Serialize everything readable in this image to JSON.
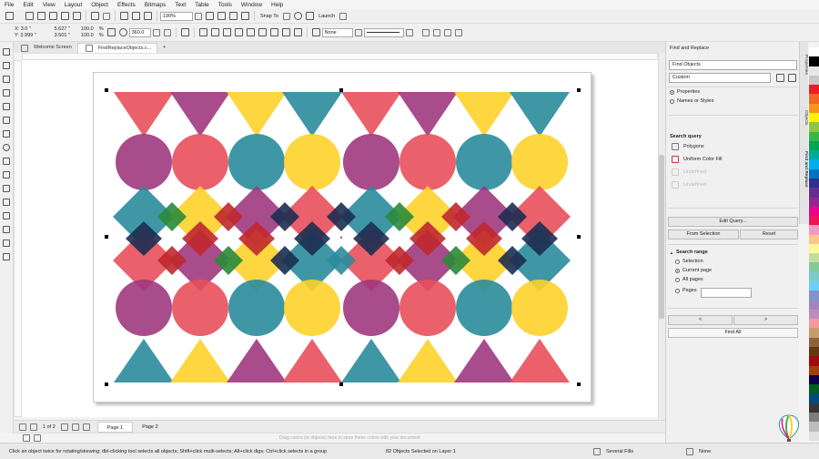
{
  "menu": [
    "File",
    "Edit",
    "View",
    "Layout",
    "Object",
    "Effects",
    "Bitmaps",
    "Text",
    "Table",
    "Tools",
    "Window",
    "Help"
  ],
  "toolbar": {
    "zoom": "190%",
    "snap_to": "Snap To",
    "launch": "Launch"
  },
  "propbar": {
    "x": "X: 3.0 \"",
    "y": "Y: 3.999 \"",
    "w": "5.627 \"",
    "h": "3.501 \"",
    "sx": "100.0",
    "sy": "100.0",
    "pct": "%",
    "angle": "360.0",
    "outline": "None"
  },
  "tabs": {
    "welcome": "Welcome Screen",
    "doc": "FindReplaceObjects.c...",
    "add": "+"
  },
  "pages": {
    "count": "1 of 2",
    "page1": "Page 1",
    "page2": "Page 2"
  },
  "hint": "Drag colors (or objects) here to store these colors with your document",
  "status": {
    "tip": "Click an object twice for rotating/skewing; dbl-clicking tool selects all objects; Shift+click multi-selects; Alt+click digs; Ctrl+click selects in a group",
    "selected": "82 Objects Selected on Layer 1",
    "fill": "Several Fills",
    "outline": "None"
  },
  "docker": {
    "title": "Find and Replace",
    "mode": "Find Objects",
    "preset": "Custom",
    "radio_properties": "Properties",
    "radio_names": "Names or Styles",
    "search_query": "Search query",
    "q1": "Polygons",
    "q2": "Uniform Color Fill",
    "q3": "Undefined",
    "q4": "Undefined",
    "edit_query": "Edit Query...",
    "from_selection": "From Selection",
    "reset": "Reset",
    "search_range": "Search range",
    "r_selection": "Selection",
    "r_current": "Current page",
    "r_all": "All pages",
    "r_pages": "Pages",
    "prev": "<",
    "next": ">",
    "find_all": "Find All"
  },
  "vtabs": [
    "Properties",
    "Objects",
    "Find and Replace"
  ],
  "colors": {
    "pink": "#e8505b",
    "purple": "#a0397e",
    "yellow": "#fdd22b",
    "teal": "#2a8c9c",
    "green": "#2a8a3a",
    "navy": "#1c2d52",
    "red": "#c0282e",
    "darkteal": "#1f5a63"
  },
  "palette": [
    "#ffffff",
    "#000000",
    "#e6e6e6",
    "#c8c8c8",
    "#ed1c24",
    "#f26522",
    "#f7941d",
    "#fff200",
    "#8dc63f",
    "#39b54a",
    "#00a651",
    "#00a99d",
    "#00aeef",
    "#0072bc",
    "#2e3192",
    "#662d91",
    "#92278f",
    "#ec008c",
    "#ed145b",
    "#f49ac1",
    "#fdc689",
    "#fff799",
    "#c4df9b",
    "#82ca9c",
    "#7accc8",
    "#6dcff6",
    "#8393ca",
    "#a186be",
    "#bd8cbf",
    "#f6989d",
    "#c69c6d",
    "#8c6239",
    "#603913",
    "#9e0b0f",
    "#a0410d",
    "#0d004c",
    "#005e20",
    "#004a80",
    "#363636",
    "#7d7d7d",
    "#bcbcbc",
    "#e1e1e1"
  ]
}
